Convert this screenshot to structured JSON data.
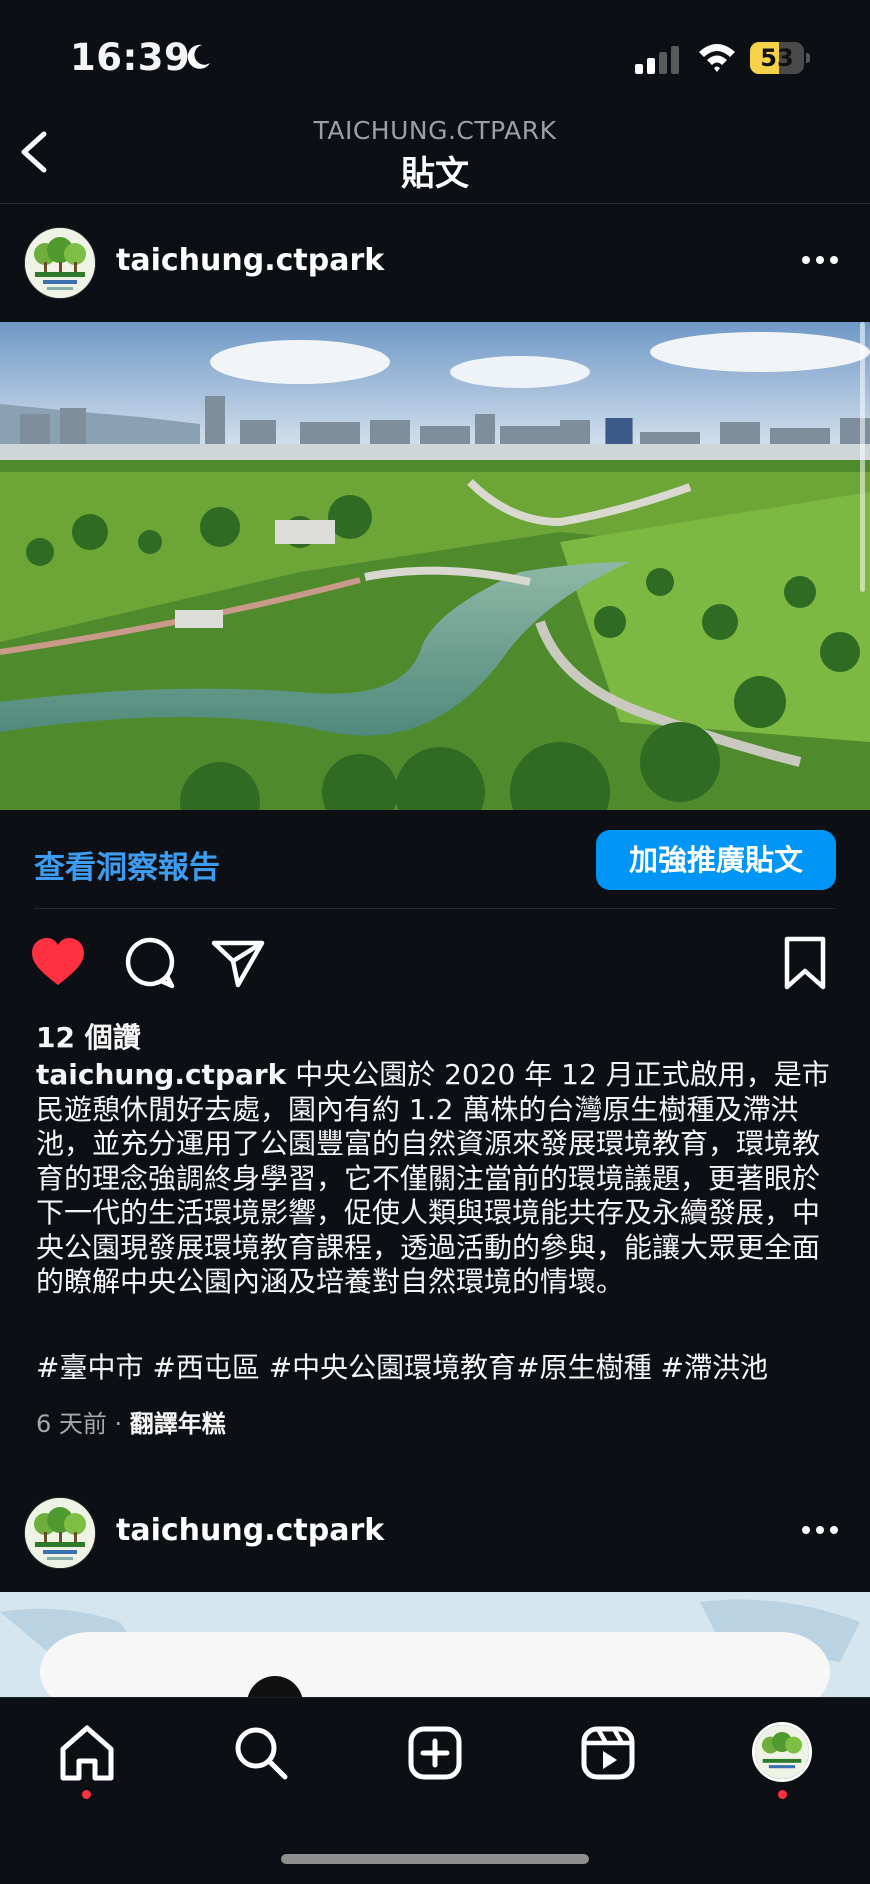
{
  "status_bar": {
    "time": "16:39",
    "battery_level": "53",
    "battery_fraction": 0.53,
    "icons": [
      "moon-icon",
      "cellular-signal-icon",
      "wifi-icon",
      "battery-icon"
    ]
  },
  "header": {
    "account": "TAICHUNG.CTPARK",
    "title": "貼文",
    "back_icon": "chevron-left-icon"
  },
  "post": {
    "username": "taichung.ctpark",
    "insights_label": "查看洞察報告",
    "boost_label": "加強推廣貼文",
    "likes": "12 個讚",
    "caption_user": "taichung.ctpark",
    "caption_text": " 中央公園於 2020 年 12 月正式啟用，是市民遊憩休閒好去處，園內有約 1.2 萬株的台灣原生樹種及滯洪池，並充分運用了公園豐富的自然資源來發展環境教育，環境教育的理念強調終身學習，它不僅關注當前的環境議題，更著眼於下一代的生活環境影響，促使人類與環境能共存及永續發展，中央公園現發展環境教育課程，透過活動的參與，能讓大眾更全面的瞭解中央公園內涵及培養對自然環境的情壞。",
    "hashtags": "#臺中市 #西屯區 #中央公園環境教育#原生樹種 #滯洪池",
    "time_ago": "6 天前",
    "separator": " · ",
    "translate_label": "翻譯年糕",
    "liked": true
  },
  "next_post": {
    "username": "taichung.ctpark"
  },
  "tab_bar": {
    "tabs": [
      "home-icon",
      "search-icon",
      "create-icon",
      "reels-icon",
      "profile-avatar"
    ],
    "notification_dots": [
      "home",
      "profile"
    ],
    "accent": "#ff3040"
  },
  "colors": {
    "background": "#0c1014",
    "link_blue": "#3d9bf0",
    "button_blue": "#0095f6",
    "like_red": "#ff3040"
  }
}
